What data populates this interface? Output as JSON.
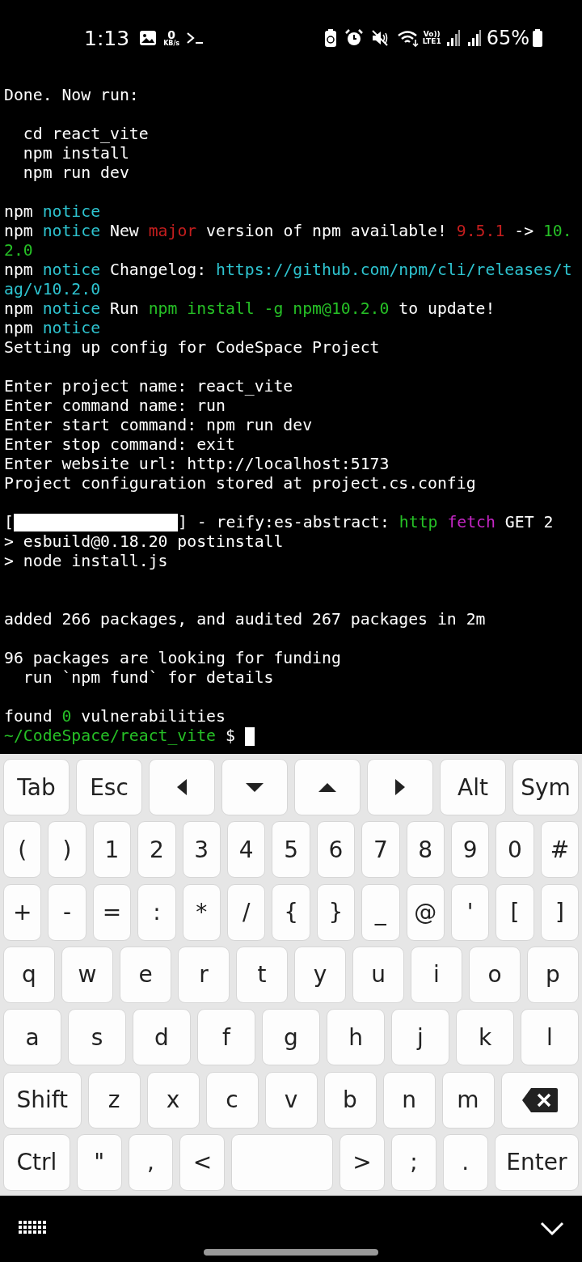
{
  "status_bar": {
    "time": "1:13",
    "speed_value": "0",
    "speed_unit": "KB/s",
    "volte": "Vo))",
    "lte": "LTE1",
    "battery": "65%"
  },
  "terminal": {
    "lines": [
      {
        "kind": "text",
        "segments": [
          {
            "t": "Done. Now run:",
            "color": "#ffffff"
          }
        ]
      },
      {
        "kind": "blank"
      },
      {
        "kind": "text",
        "segments": [
          {
            "t": "  cd react_vite",
            "color": "#ffffff"
          }
        ]
      },
      {
        "kind": "text",
        "segments": [
          {
            "t": "  npm install",
            "color": "#ffffff"
          }
        ]
      },
      {
        "kind": "text",
        "segments": [
          {
            "t": "  npm run dev",
            "color": "#ffffff"
          }
        ]
      },
      {
        "kind": "blank"
      },
      {
        "kind": "text",
        "segments": [
          {
            "t": "npm ",
            "color": "#ffffff"
          },
          {
            "t": "notice",
            "color": "#2ec4d0"
          }
        ]
      },
      {
        "kind": "text",
        "segments": [
          {
            "t": "npm ",
            "color": "#ffffff"
          },
          {
            "t": "notice",
            "color": "#2ec4d0"
          },
          {
            "t": " New ",
            "color": "#ffffff"
          },
          {
            "t": "major",
            "color": "#c51e1e"
          },
          {
            "t": " version of npm available! ",
            "color": "#ffffff"
          },
          {
            "t": "9.5.1",
            "color": "#c51e1e"
          },
          {
            "t": " -> ",
            "color": "#ffffff"
          },
          {
            "t": "10.",
            "color": "#26c026"
          }
        ]
      },
      {
        "kind": "text",
        "segments": [
          {
            "t": "2.0",
            "color": "#26c026"
          }
        ]
      },
      {
        "kind": "text",
        "segments": [
          {
            "t": "npm ",
            "color": "#ffffff"
          },
          {
            "t": "notice",
            "color": "#2ec4d0"
          },
          {
            "t": " Changelog: ",
            "color": "#ffffff"
          },
          {
            "t": "https://github.com/npm/cli/releases/t",
            "color": "#2ec4d0"
          }
        ]
      },
      {
        "kind": "text",
        "segments": [
          {
            "t": "ag/v10.2.0",
            "color": "#2ec4d0"
          }
        ]
      },
      {
        "kind": "text",
        "segments": [
          {
            "t": "npm ",
            "color": "#ffffff"
          },
          {
            "t": "notice",
            "color": "#2ec4d0"
          },
          {
            "t": " Run ",
            "color": "#ffffff"
          },
          {
            "t": "npm install -g npm@10.2.0",
            "color": "#26c026"
          },
          {
            "t": " to update!",
            "color": "#ffffff"
          }
        ]
      },
      {
        "kind": "text",
        "segments": [
          {
            "t": "npm ",
            "color": "#ffffff"
          },
          {
            "t": "notice",
            "color": "#2ec4d0"
          }
        ]
      },
      {
        "kind": "text",
        "segments": [
          {
            "t": "Setting up config for CodeSpace Project",
            "color": "#ffffff"
          }
        ]
      },
      {
        "kind": "blank"
      },
      {
        "kind": "text",
        "segments": [
          {
            "t": "Enter project name: react_vite",
            "color": "#ffffff"
          }
        ]
      },
      {
        "kind": "text",
        "segments": [
          {
            "t": "Enter command name: run",
            "color": "#ffffff"
          }
        ]
      },
      {
        "kind": "text",
        "segments": [
          {
            "t": "Enter start command: npm run dev",
            "color": "#ffffff"
          }
        ]
      },
      {
        "kind": "text",
        "segments": [
          {
            "t": "Enter stop command: exit",
            "color": "#ffffff"
          }
        ]
      },
      {
        "kind": "text",
        "segments": [
          {
            "t": "Enter website url: http://localhost:5173",
            "color": "#ffffff"
          }
        ]
      },
      {
        "kind": "text",
        "segments": [
          {
            "t": "Project configuration stored at project.cs.config",
            "color": "#ffffff"
          }
        ]
      },
      {
        "kind": "blank"
      },
      {
        "kind": "progress",
        "level": 1,
        "before": "[",
        "after": "] - reify:es-abstract: ",
        "segments": [
          {
            "t": "http ",
            "color": "#26c026"
          },
          {
            "t": "fetch",
            "color": "#c526c5"
          },
          {
            "t": " GET 2",
            "color": "#ffffff"
          }
        ]
      },
      {
        "kind": "text",
        "segments": [
          {
            "t": "> esbuild@0.18.20 postinstall",
            "color": "#ffffff"
          }
        ]
      },
      {
        "kind": "text",
        "segments": [
          {
            "t": "> node install.js",
            "color": "#ffffff"
          }
        ]
      },
      {
        "kind": "blank"
      },
      {
        "kind": "blank"
      },
      {
        "kind": "text",
        "segments": [
          {
            "t": "added 266 packages, and audited 267 packages in 2m",
            "color": "#ffffff"
          }
        ]
      },
      {
        "kind": "blank"
      },
      {
        "kind": "text",
        "segments": [
          {
            "t": "96 packages are looking for funding",
            "color": "#ffffff"
          }
        ]
      },
      {
        "kind": "text",
        "segments": [
          {
            "t": "  run `npm fund` for details",
            "color": "#ffffff"
          }
        ]
      },
      {
        "kind": "blank"
      },
      {
        "kind": "text",
        "segments": [
          {
            "t": "found ",
            "color": "#ffffff"
          },
          {
            "t": "0",
            "color": "#26c026"
          },
          {
            "t": " vulnerabilities",
            "color": "#ffffff"
          }
        ]
      },
      {
        "kind": "prompt",
        "segments": [
          {
            "t": "~/CodeSpace/react_vite",
            "color": "#26c026"
          },
          {
            "t": " $",
            "color": "#ffffff"
          }
        ]
      }
    ]
  },
  "extra_keys": [
    {
      "kind": "key",
      "label": "Tab"
    },
    {
      "kind": "key",
      "label": "Esc"
    },
    {
      "kind": "left"
    },
    {
      "kind": "down"
    },
    {
      "kind": "up"
    },
    {
      "kind": "right"
    },
    {
      "kind": "key",
      "label": "Alt"
    },
    {
      "kind": "key",
      "label": "Sym"
    }
  ],
  "keyboard": {
    "number_keys": [
      {
        "kind": "key",
        "label": "("
      },
      {
        "kind": "key",
        "label": ")"
      },
      {
        "kind": "key",
        "label": "1"
      },
      {
        "kind": "key",
        "label": "2"
      },
      {
        "kind": "key",
        "label": "3"
      },
      {
        "kind": "key",
        "label": "4"
      },
      {
        "kind": "key",
        "label": "5"
      },
      {
        "kind": "key",
        "label": "6"
      },
      {
        "kind": "key",
        "label": "7"
      },
      {
        "kind": "key",
        "label": "8"
      },
      {
        "kind": "key",
        "label": "9"
      },
      {
        "kind": "key",
        "label": "0"
      },
      {
        "kind": "key",
        "label": "#"
      }
    ],
    "symbol_keys": [
      {
        "kind": "key",
        "label": "+"
      },
      {
        "kind": "key",
        "label": "-"
      },
      {
        "kind": "key",
        "label": "="
      },
      {
        "kind": "key",
        "label": ":"
      },
      {
        "kind": "key",
        "label": "*"
      },
      {
        "kind": "key",
        "label": "/"
      },
      {
        "kind": "key",
        "label": "{"
      },
      {
        "kind": "key",
        "label": "}"
      },
      {
        "kind": "key",
        "label": "_"
      },
      {
        "kind": "key",
        "label": "@"
      },
      {
        "kind": "key",
        "label": "'"
      },
      {
        "kind": "key",
        "label": "["
      },
      {
        "kind": "key",
        "label": "]"
      }
    ],
    "top_letters": [
      {
        "kind": "key",
        "label": "q"
      },
      {
        "kind": "key",
        "label": "w"
      },
      {
        "kind": "key",
        "label": "e"
      },
      {
        "kind": "key",
        "label": "r"
      },
      {
        "kind": "key",
        "label": "t"
      },
      {
        "kind": "key",
        "label": "y"
      },
      {
        "kind": "key",
        "label": "u"
      },
      {
        "kind": "key",
        "label": "i"
      },
      {
        "kind": "key",
        "label": "o"
      },
      {
        "kind": "key",
        "label": "p"
      }
    ],
    "middle_letters": [
      {
        "kind": "key",
        "label": "a"
      },
      {
        "kind": "key",
        "label": "s"
      },
      {
        "kind": "key",
        "label": "d"
      },
      {
        "kind": "key",
        "label": "f"
      },
      {
        "kind": "key",
        "label": "g"
      },
      {
        "kind": "key",
        "label": "h"
      },
      {
        "kind": "key",
        "label": "j"
      },
      {
        "kind": "key",
        "label": "k"
      },
      {
        "kind": "key",
        "label": "l"
      }
    ],
    "bottom_letters": [
      {
        "kind": "wide",
        "label": "Shift"
      },
      {
        "kind": "key",
        "label": "z"
      },
      {
        "kind": "key",
        "label": "x"
      },
      {
        "kind": "key",
        "label": "c"
      },
      {
        "kind": "key",
        "label": "v"
      },
      {
        "kind": "key",
        "label": "b"
      },
      {
        "kind": "key",
        "label": "n"
      },
      {
        "kind": "key",
        "label": "m"
      },
      {
        "kind": "backspace"
      }
    ],
    "control_keys": [
      {
        "kind": "wide",
        "label": "Ctrl"
      },
      {
        "kind": "key",
        "label": "\""
      },
      {
        "kind": "key",
        "label": ","
      },
      {
        "kind": "key",
        "label": "<"
      },
      {
        "kind": "space"
      },
      {
        "kind": "key",
        "label": ">"
      },
      {
        "kind": "key",
        "label": ";"
      },
      {
        "kind": "key",
        "label": "."
      },
      {
        "kind": "enter",
        "label": "Enter"
      }
    ]
  }
}
